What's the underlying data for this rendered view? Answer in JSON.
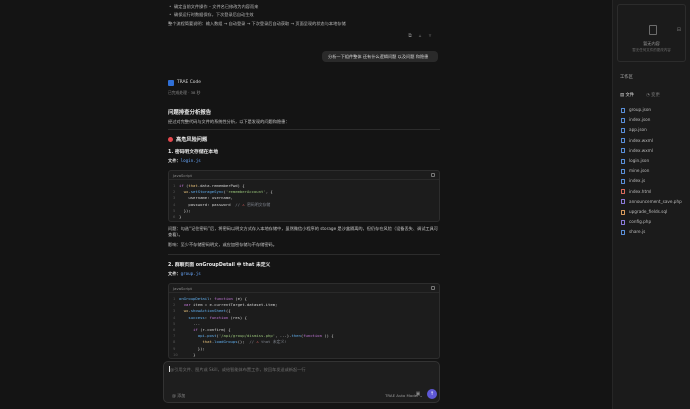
{
  "chat": {
    "bullets": [
      "确定当前文件操作 – 文件名已修改为内容而来",
      "确保运行时数据保存，下次登录后自动生效"
    ],
    "flow": "整个流程简要说明：输入数组 → 自动登录 → 下次登录后自动获取 → 页面呈现的状态与本地存储",
    "user_message": "分析一下组件整体 还有什么逻辑问题 以及问题 和隐患",
    "assistant_name": "TRAE Code",
    "meta": "已完成处理 · 38 秒",
    "report_title": "问题排查分析报告",
    "report_intro": "经过对完整代码与文件的系统性分析，以下是发现的问题和隐患：",
    "section1_title": "高危风险问题",
    "issue1_title": "1. 密码明文存储在本地",
    "file_label": "文件：",
    "issue1_file": "login.js",
    "code1_lang": "JavaScript",
    "code1_lines": [
      {
        "n": "1",
        "html": "<span class='kw'>if</span> <span class='pl'>(</span><span class='prop'>that</span><span class='pl'>.data.rememberPwd) {</span>"
      },
      {
        "n": "2",
        "html": "  <span class='prop'>wx</span><span class='pl'>.</span><span class='fn'>setStorageSync</span><span class='pl'>(</span><span class='str'>'rememberAccount'</span><span class='pl'>, {</span>"
      },
      {
        "n": "3",
        "html": "    <span class='pl'>username: username,</span>"
      },
      {
        "n": "4",
        "html": "    <span class='pl'>password: password  </span><span class='cm'>// </span><span class='err'>⚠</span><span class='cm'> 密码明文存储</span>"
      },
      {
        "n": "5",
        "html": "  <span class='pl'>});</span>"
      },
      {
        "n": "6",
        "html": "<span class='pl'>}</span>"
      }
    ],
    "issue1_desc": "问题：勾选“记住密码”后，将密码以明文方式存入本地存储中，虽然微信小程序的 storage 是沙盒隔离的，但仍存在风险（设备丢失、调试工具可查看）。",
    "issue1_impact": "影响：至少不存储密码明文，或应加密存储与不存储密码。",
    "issue2_title": "2. 群聊页面 onGroupDetail 中 that 未定义",
    "issue2_file": "group.js",
    "code2_lang": "JavaScript",
    "code2_lines": [
      {
        "n": "1",
        "html": "<span class='fn'>onGroupDetail</span><span class='pl'>: </span><span class='kw'>function</span><span class='pl'> (e) {</span>"
      },
      {
        "n": "2",
        "html": "  <span class='kw'>var</span><span class='pl'> item = e.currentTarget.dataset.item;</span>"
      },
      {
        "n": "3",
        "html": "  <span class='prop'>wx</span><span class='pl'>.</span><span class='fn'>showActionSheet</span><span class='pl'>({</span>"
      },
      {
        "n": "4",
        "html": "    <span class='fn'>success</span><span class='pl'>: </span><span class='kw'>function</span><span class='pl'> (res) {</span>"
      },
      {
        "n": "5",
        "html": "      <span class='pl'>...</span>"
      },
      {
        "n": "6",
        "html": "      <span class='kw'>if</span><span class='pl'> (r.confirm) {</span>"
      },
      {
        "n": "7",
        "html": "        <span class='fn'>api</span><span class='pl'>.</span><span class='fn'>post</span><span class='pl'>(</span><span class='str'>'/api/group/dismiss.php'</span><span class='pl'>, ...).</span><span class='fn'>then</span><span class='pl'>(</span><span class='kw'>function</span><span class='pl'> () {</span>"
      },
      {
        "n": "8",
        "html": "          <span class='prop'>that</span><span class='pl'>.</span><span class='fn'>loadGroups</span><span class='pl'>();  </span><span class='cm'>// </span><span class='err'>⚠</span><span class='cm'> that 未定义!</span>"
      },
      {
        "n": "9",
        "html": "        <span class='pl'>});</span>"
      },
      {
        "n": "10",
        "html": "      <span class='pl'>}</span>"
      }
    ],
    "input_placeholder": "@引用文件、图片或 Skill，或给智能体布置工作，按回车发送或新起一行",
    "tool_label": "@ 添加",
    "model_label": "TRAE Auto Model"
  },
  "panel": {
    "box_title": "暂无内容",
    "box_sub": "暂无任何文件的更改内容",
    "filetree_title": "工作区",
    "tabs": [
      "文件",
      "变更"
    ],
    "files": [
      {
        "name": "group.json",
        "type": "json"
      },
      {
        "name": "index.json",
        "type": "json"
      },
      {
        "name": "app.json",
        "type": "json"
      },
      {
        "name": "index.wxml",
        "type": "wxml"
      },
      {
        "name": "index.wxml",
        "type": "wxml"
      },
      {
        "name": "login.json",
        "type": "json"
      },
      {
        "name": "mine.json",
        "type": "json"
      },
      {
        "name": "index.js",
        "type": "js"
      },
      {
        "name": "index.html",
        "type": "html"
      },
      {
        "name": "announcement_save.php",
        "type": "php"
      },
      {
        "name": "upgrade_fields.sql",
        "type": "sql"
      },
      {
        "name": "config.php",
        "type": "php"
      },
      {
        "name": "share.js",
        "type": "js"
      }
    ]
  }
}
